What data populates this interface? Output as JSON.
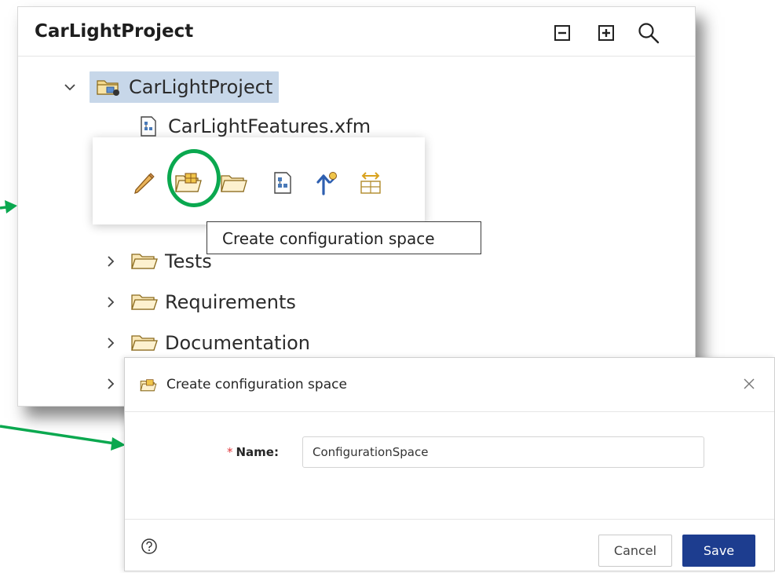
{
  "explorer": {
    "title": "CarLightProject",
    "header_icons": [
      "collapse-all-icon",
      "expand-all-icon",
      "search-icon"
    ],
    "tree": {
      "root": {
        "label": "CarLightProject",
        "expanded": true,
        "selected": true
      },
      "items": [
        {
          "label": "CarLightFeatures.xfm",
          "type": "file"
        },
        {
          "label": "Tests",
          "type": "folder",
          "expanded": false
        },
        {
          "label": "Requirements",
          "type": "folder",
          "expanded": false
        },
        {
          "label": "Documentation",
          "type": "folder",
          "expanded": false
        }
      ]
    }
  },
  "toolbar": {
    "icons": [
      "rename-pencil-icon",
      "create-configuration-space-icon",
      "folder-icon",
      "feature-model-file-icon",
      "new-feature-icon",
      "variant-table-icon"
    ],
    "highlighted": "create-configuration-space-icon",
    "tooltip": "Create configuration space"
  },
  "dialog": {
    "title": "Create configuration space",
    "required_mark": "*",
    "name_label": "Name:",
    "name_value": "ConfigurationSpace",
    "cancel_label": "Cancel",
    "save_label": "Save"
  },
  "colors": {
    "selection": "#c7d7e9",
    "accent_green": "#0aa84f",
    "save_button": "#1d3d8f",
    "required_star": "#e0393e"
  }
}
